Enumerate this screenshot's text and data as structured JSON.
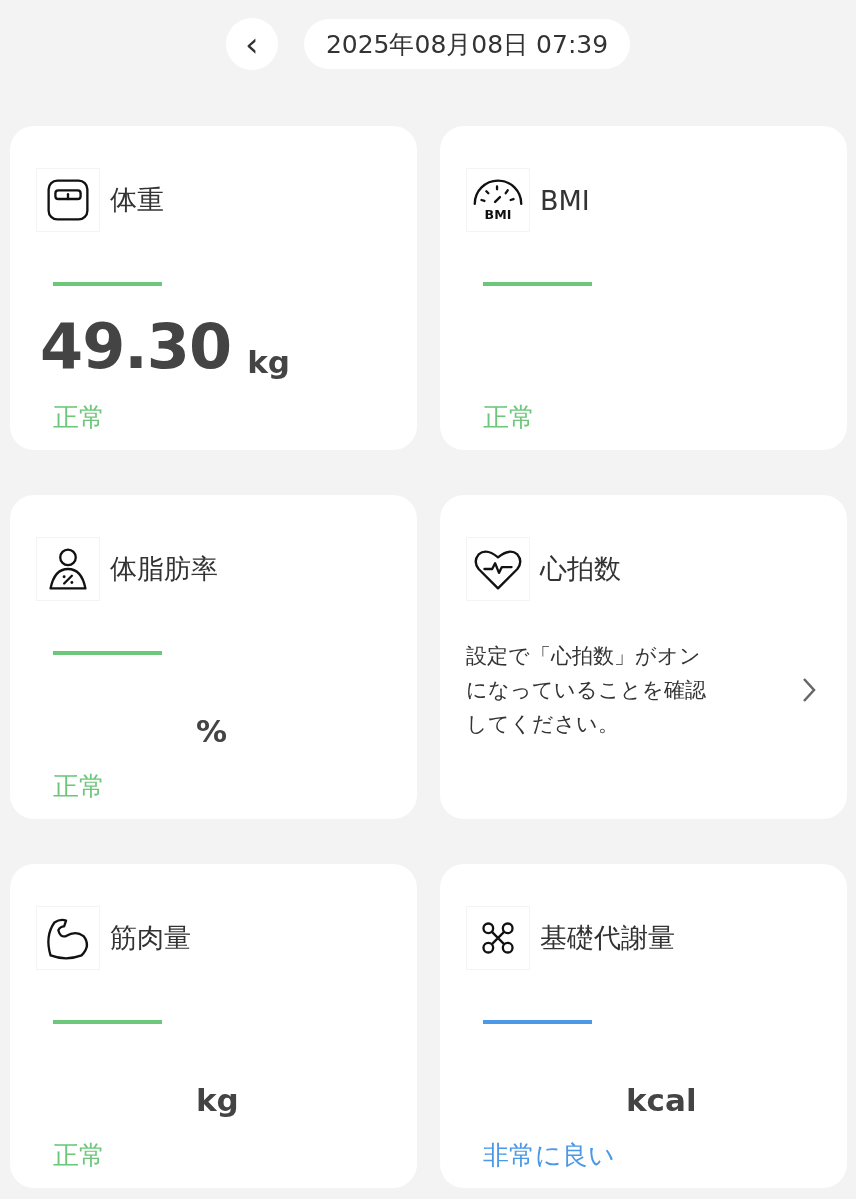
{
  "header": {
    "back": "‹",
    "date": "2025年08月08日 07:39"
  },
  "cards": [
    {
      "kind": "metric",
      "title": "体重",
      "color": "#6cc77a",
      "value": "49.30",
      "unit": "kg",
      "status": "正常"
    },
    {
      "kind": "metric",
      "icon_text": "BMI",
      "title": "BMI",
      "color": "#6cc77a",
      "status": "正常"
    },
    {
      "kind": "metric",
      "title": "体脂肪率",
      "color": "#6cc77a",
      "unit": "%",
      "status": "正常"
    },
    {
      "kind": "message",
      "title": "心拍数",
      "message": "設定で「心拍数」がオンになっていることを確認してください。"
    },
    {
      "kind": "metric",
      "title": "筋肉量",
      "color": "#6cc77a",
      "unit": "kg",
      "status": "正常"
    },
    {
      "kind": "metric",
      "title": "基礎代謝量",
      "color": "#4a98e6",
      "unit": "kcal",
      "status": "非常に良い"
    }
  ]
}
